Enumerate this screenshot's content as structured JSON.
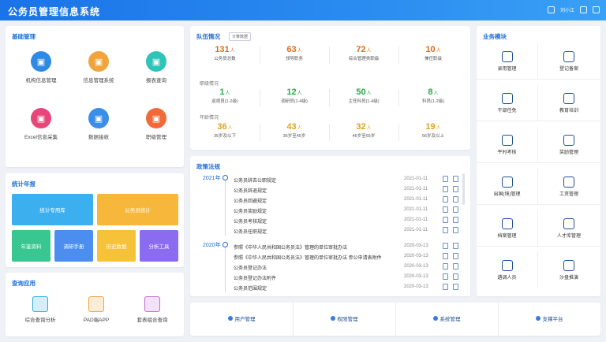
{
  "app": {
    "title": "公务员管理信息系统",
    "user_label": "刘小江"
  },
  "basic": {
    "title": "基础管理",
    "items": [
      {
        "label": "机构信息管理",
        "icon": "building-icon",
        "color": "#2f8ae6"
      },
      {
        "label": "信息管理系统",
        "icon": "users-icon",
        "color": "#f0a43a"
      },
      {
        "label": "报表查询",
        "icon": "report-icon",
        "color": "#2fc4b8"
      },
      {
        "label": "Excel信息采集",
        "icon": "excel-icon",
        "color": "#e8457a"
      },
      {
        "label": "数据接收",
        "icon": "download-icon",
        "color": "#3a8de8"
      },
      {
        "label": "职级管理",
        "icon": "folder-icon",
        "color": "#f26a3a"
      }
    ]
  },
  "stats": {
    "title": "统计年报",
    "tiles": [
      {
        "label": "统计专用库",
        "color": "#3cb0ee"
      },
      {
        "label": "公务员统计",
        "color": "#f7b73a"
      },
      {
        "label": "年鉴资料",
        "color": "#39c690"
      },
      {
        "label": "调研手册",
        "color": "#4b8ef0"
      },
      {
        "label": "历史数据",
        "color": "#f6c23a"
      },
      {
        "label": "分析工具",
        "color": "#8b6cf0"
      }
    ]
  },
  "query": {
    "title": "查询应用",
    "items": [
      {
        "label": "综合查询分析",
        "icon": "query-icon",
        "color": "#2fa8e6"
      },
      {
        "label": "PAD端APP",
        "icon": "tablet-icon",
        "color": "#f0a23a"
      },
      {
        "label": "套表组合查询",
        "icon": "table-icon",
        "color": "#c06ad8"
      }
    ]
  },
  "team": {
    "title": "队伍情况",
    "tag": "计算数据",
    "unit": "人",
    "row1": [
      {
        "num": "131",
        "label": "公务员总数",
        "color": "#e06a1a"
      },
      {
        "num": "63",
        "label": "领导职务",
        "color": "#e06a1a"
      },
      {
        "num": "72",
        "label": "综合管理类职级",
        "color": "#e06a1a"
      },
      {
        "num": "10",
        "label": "兼任职级",
        "color": "#e06a1a"
      }
    ],
    "section2": "职级情况",
    "row2": [
      {
        "num": "1",
        "label": "巡视员(1-2级)",
        "color": "#2aa84a"
      },
      {
        "num": "12",
        "label": "调研员(1-4级)",
        "color": "#2aa84a"
      },
      {
        "num": "50",
        "label": "主任科员(1-4级)",
        "color": "#2aa84a"
      },
      {
        "num": "8",
        "label": "科员(1-2级)",
        "color": "#2aa84a"
      }
    ],
    "section3": "年龄情况",
    "row3": [
      {
        "num": "36",
        "label": "35岁及以下",
        "color": "#e0a21a"
      },
      {
        "num": "43",
        "label": "36岁至45岁",
        "color": "#e0a21a"
      },
      {
        "num": "32",
        "label": "46岁至55岁",
        "color": "#e0a21a"
      },
      {
        "num": "19",
        "label": "56岁及以上",
        "color": "#e0a21a"
      }
    ]
  },
  "policy": {
    "title": "政策法规",
    "years": [
      {
        "year": "2021年",
        "rows": [
          {
            "text": "公务员辞去公职规定",
            "date": "2021-01-11"
          },
          {
            "text": "公务员辞退规定",
            "date": "2021-01-11"
          },
          {
            "text": "公务员回避规定",
            "date": "2021-01-11"
          },
          {
            "text": "公务员奖励规定",
            "date": "2021-01-11"
          },
          {
            "text": "公务员考核规定",
            "date": "2021-01-11"
          },
          {
            "text": "公务员任职规定",
            "date": "2021-01-11"
          }
        ]
      },
      {
        "year": "2020年",
        "rows": [
          {
            "text": "参照《中华人民共和国公务员法》管理的单位审批办法",
            "date": "2020-03-13"
          },
          {
            "text": "参照《中华人民共和国公务员法》管理的单位审批办法 参公申请表附件",
            "date": "2020-03-13"
          },
          {
            "text": "公务员登记办法",
            "date": "2020-03-13"
          },
          {
            "text": "公务员登记办法附件",
            "date": "2020-03-13"
          },
          {
            "text": "公务员范围规定",
            "date": "2020-03-13"
          }
        ]
      }
    ]
  },
  "business": {
    "title": "业务模块",
    "items": [
      {
        "label": "录用管理",
        "icon": "hire-icon"
      },
      {
        "label": "登记备案",
        "icon": "register-icon"
      },
      {
        "label": "干部任免",
        "icon": "appoint-icon"
      },
      {
        "label": "教育培训",
        "icon": "training-icon"
      },
      {
        "label": "平时考核",
        "icon": "assess-icon"
      },
      {
        "label": "奖励管理",
        "icon": "reward-icon"
      },
      {
        "label": "出国(境)管理",
        "icon": "abroad-icon"
      },
      {
        "label": "工资管理",
        "icon": "salary-icon"
      },
      {
        "label": "档案管理",
        "icon": "archive-icon"
      },
      {
        "label": "人才库管理",
        "icon": "talent-icon"
      },
      {
        "label": "遴调人员",
        "icon": "transfer-icon"
      },
      {
        "label": "沙盘推演",
        "icon": "sandbox-icon"
      }
    ]
  },
  "bottom_nav": [
    {
      "label": "用户管理",
      "icon": "user-icon"
    },
    {
      "label": "权限管理",
      "icon": "key-icon"
    },
    {
      "label": "系统管理",
      "icon": "gear-icon"
    },
    {
      "label": "支撑平台",
      "icon": "monitor-icon"
    }
  ]
}
